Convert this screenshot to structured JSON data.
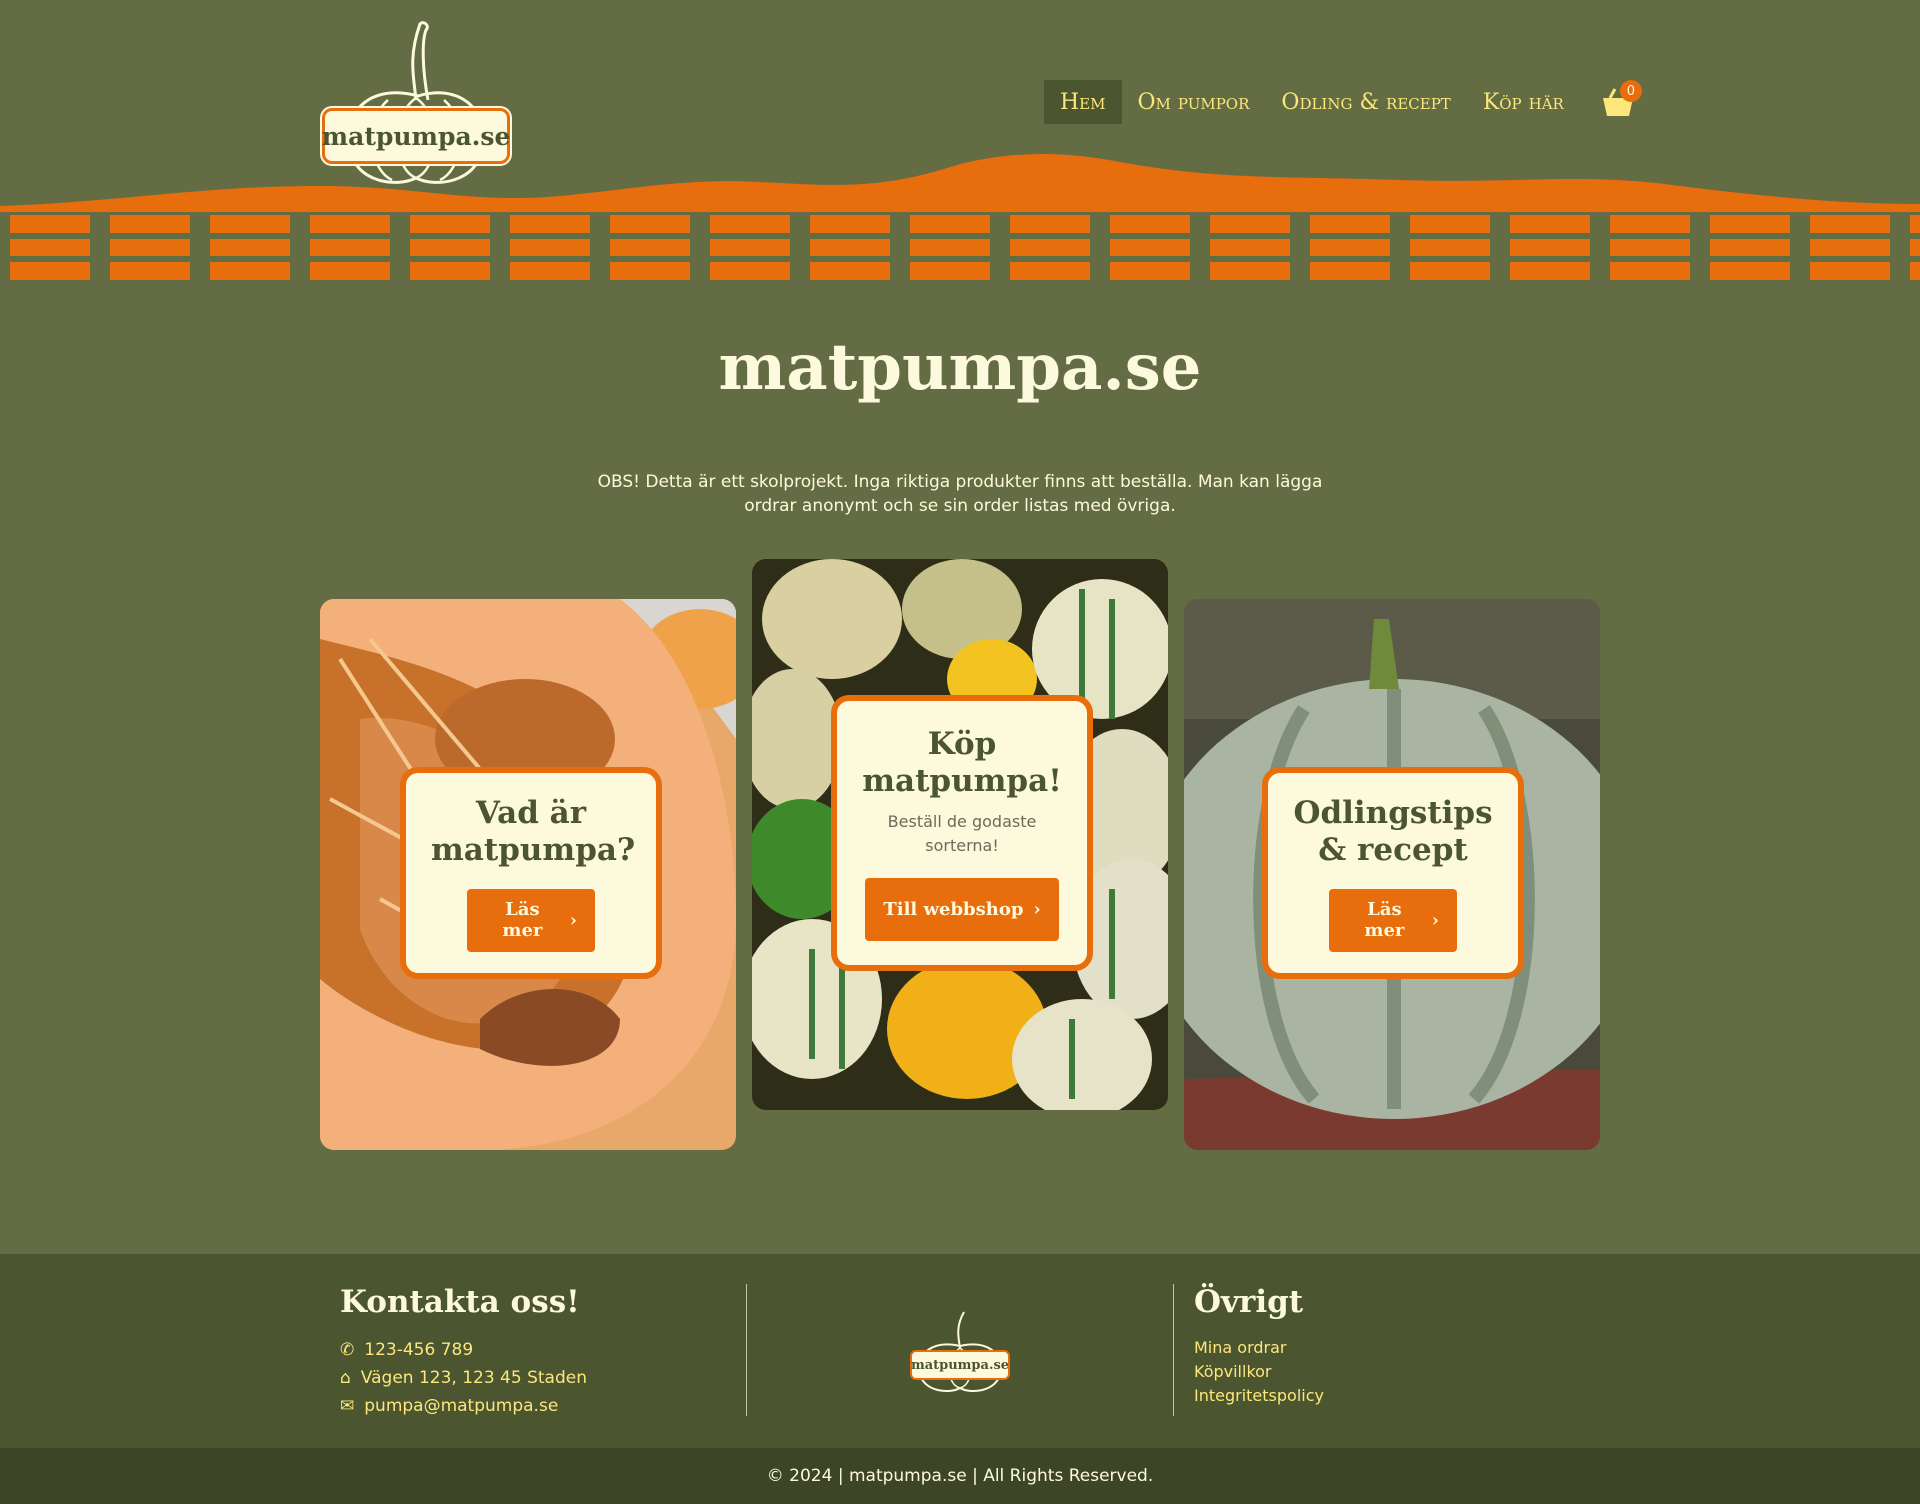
{
  "header": {
    "logo_text": "matpumpa.se",
    "nav": [
      {
        "label": "Hem",
        "active": true
      },
      {
        "label": "Om pumpor",
        "active": false
      },
      {
        "label": "Odling & recept",
        "active": false
      },
      {
        "label": "Köp här",
        "active": false
      }
    ],
    "cart_count": "0",
    "cart_icon": "basket-icon"
  },
  "main": {
    "title": "matpumpa.se",
    "notice": "OBS! Detta är ett skolprojekt. Inga riktiga produkter finns att beställa. Man kan lägga ordrar anonymt och se sin order listas med övriga.",
    "cards": [
      {
        "title": "Vad är matpumpa?",
        "subtitle": "",
        "button": "Läs mer",
        "image": "cut-pumpkin-photo"
      },
      {
        "title": "Köp matpumpa!",
        "subtitle": "Beställ de godaste sorterna!",
        "button": "Till webbshop",
        "image": "pumpkin-pile-photo"
      },
      {
        "title": "Odlingstips & recept",
        "subtitle": "",
        "button": "Läs mer",
        "image": "grey-pumpkin-photo"
      }
    ]
  },
  "footer": {
    "contact_title": "Kontakta oss!",
    "phone": "123-456 789",
    "address": "Vägen 123, 123 45 Staden",
    "email": "pumpa@matpumpa.se",
    "logo_text": "matpumpa.se",
    "other_title": "Övrigt",
    "links": [
      "Mina ordrar",
      "Köpvillkor",
      "Integritetspolicy"
    ],
    "copyright": "© 2024 | matpumpa.se | All Rights Reserved."
  },
  "colors": {
    "background": "#636c43",
    "accent": "#e86d0c",
    "cream": "#fdf9dc",
    "nav_text": "#fbe77b",
    "footer": "#4b5530"
  }
}
